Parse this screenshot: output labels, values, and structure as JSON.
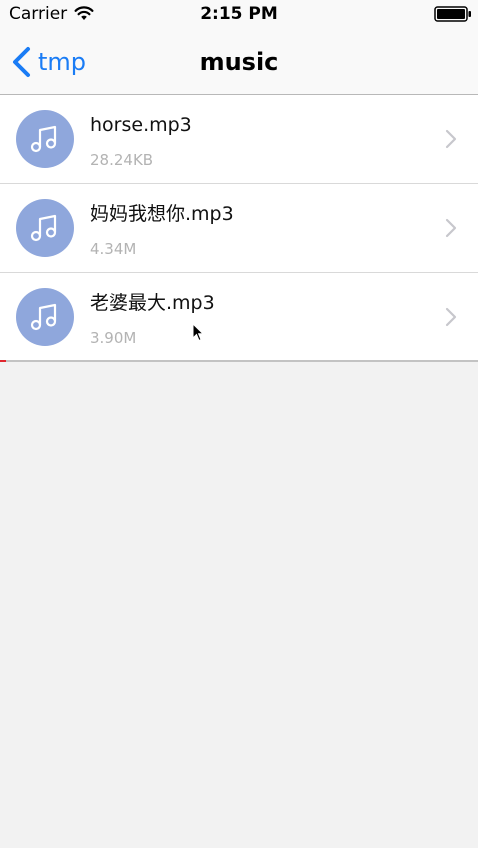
{
  "status_bar": {
    "carrier": "Carrier",
    "time": "2:15 PM",
    "icons": [
      "wifi-icon",
      "battery-icon"
    ]
  },
  "nav": {
    "back_label": "tmp",
    "title": "music",
    "accent_color": "#1a7cf5"
  },
  "files": [
    {
      "name": "horse.mp3",
      "size": "28.24KB",
      "icon": "music-note-icon"
    },
    {
      "name": "妈妈我想你.mp3",
      "size": "4.34M",
      "icon": "music-note-icon"
    },
    {
      "name": "老婆最大.mp3",
      "size": "3.90M",
      "icon": "music-note-icon"
    }
  ],
  "colors": {
    "avatar_bg": "#8fa7dc",
    "background": "#f2f2f2",
    "secondary_text": "#b3b3b3"
  }
}
